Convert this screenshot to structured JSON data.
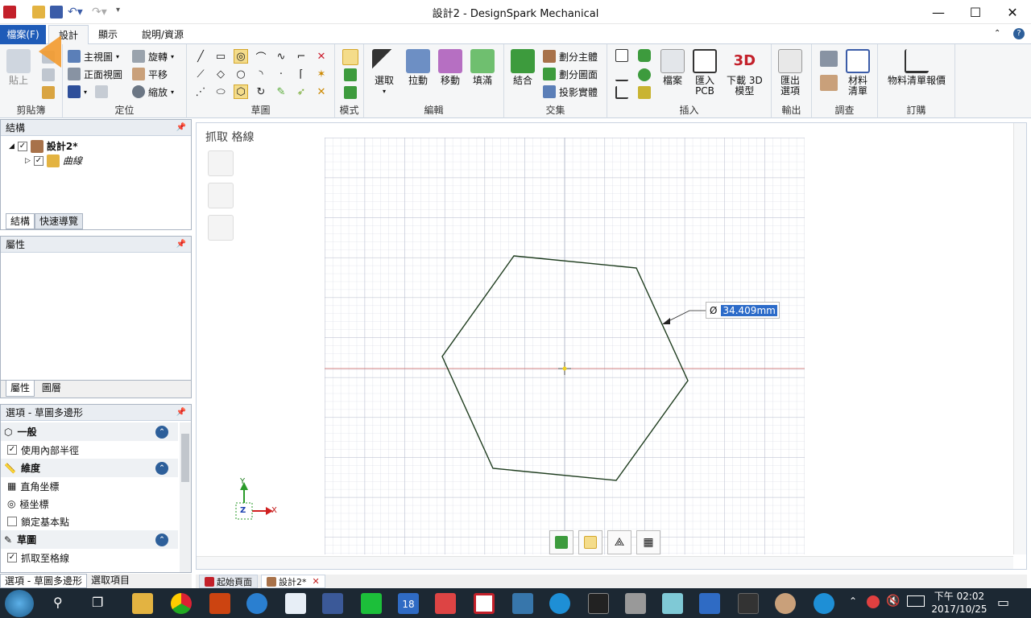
{
  "window": {
    "title": "設計2 - DesignSpark Mechanical",
    "minimize": "—",
    "maximize": "☐",
    "close": "✕"
  },
  "menu": {
    "file": "檔案(F)",
    "tabs": [
      "設計",
      "顯示",
      "說明/資源"
    ]
  },
  "ribbon": {
    "clipboard": {
      "label": "剪貼簿",
      "paste": "貼上"
    },
    "orient": {
      "label": "定位",
      "home": "主視圖",
      "front": "正面視圖",
      "rotate": "旋轉",
      "pan": "平移",
      "zoom": "縮放"
    },
    "sketch": {
      "label": "草圖"
    },
    "mode": {
      "label": "模式"
    },
    "edit": {
      "label": "編輯",
      "select": "選取",
      "pull": "拉動",
      "move": "移動",
      "fill": "填滿"
    },
    "intersect": {
      "label": "交集",
      "combine": "結合",
      "split_body": "劃分主體",
      "split_face": "劃分圖面",
      "project": "投影實體"
    },
    "insert": {
      "label": "插入",
      "file": "檔案",
      "import_pcb": "匯入\nPCB",
      "download_3d": "下載 3D\n模型"
    },
    "output": {
      "label": "輸出",
      "export": "匯出\n選項"
    },
    "investigate": {
      "label": "調查",
      "bom": "材料\n清單"
    },
    "order": {
      "label": "訂購",
      "bom_report": "物料清單報價"
    }
  },
  "structure": {
    "title": "結構",
    "root": "設計2*",
    "child": "曲線",
    "tabs": [
      "結構",
      "快速導覽"
    ]
  },
  "properties": {
    "title": "屬性",
    "tabs": [
      "屬性",
      "圖層"
    ]
  },
  "options": {
    "title": "選項 - 草圖多邊形",
    "sections": [
      {
        "title": "一般",
        "items": [
          {
            "label": "使用內部半徑",
            "checked": true
          }
        ]
      },
      {
        "title": "維度",
        "items": [
          {
            "label": "直角坐標"
          },
          {
            "label": "極坐標"
          },
          {
            "label": "鎖定基本點",
            "checked": false
          }
        ]
      },
      {
        "title": "草圖",
        "items": [
          {
            "label": "抓取至格線",
            "checked": true
          }
        ]
      }
    ],
    "bottom_tabs": [
      "選項 - 草圖多邊形",
      "選取項目"
    ]
  },
  "viewport": {
    "snap_label": "抓取 格線",
    "dimension_symbol": "Ø",
    "dimension_value": "34.409mm",
    "axis_x": "X",
    "axis_y": "Y",
    "axis_z": "Z"
  },
  "doc_tabs": [
    "起始頁面",
    "設計2*"
  ],
  "taskbar": {
    "time": "下午 02:02",
    "date": "2017/10/25",
    "calendar_day": "18"
  }
}
